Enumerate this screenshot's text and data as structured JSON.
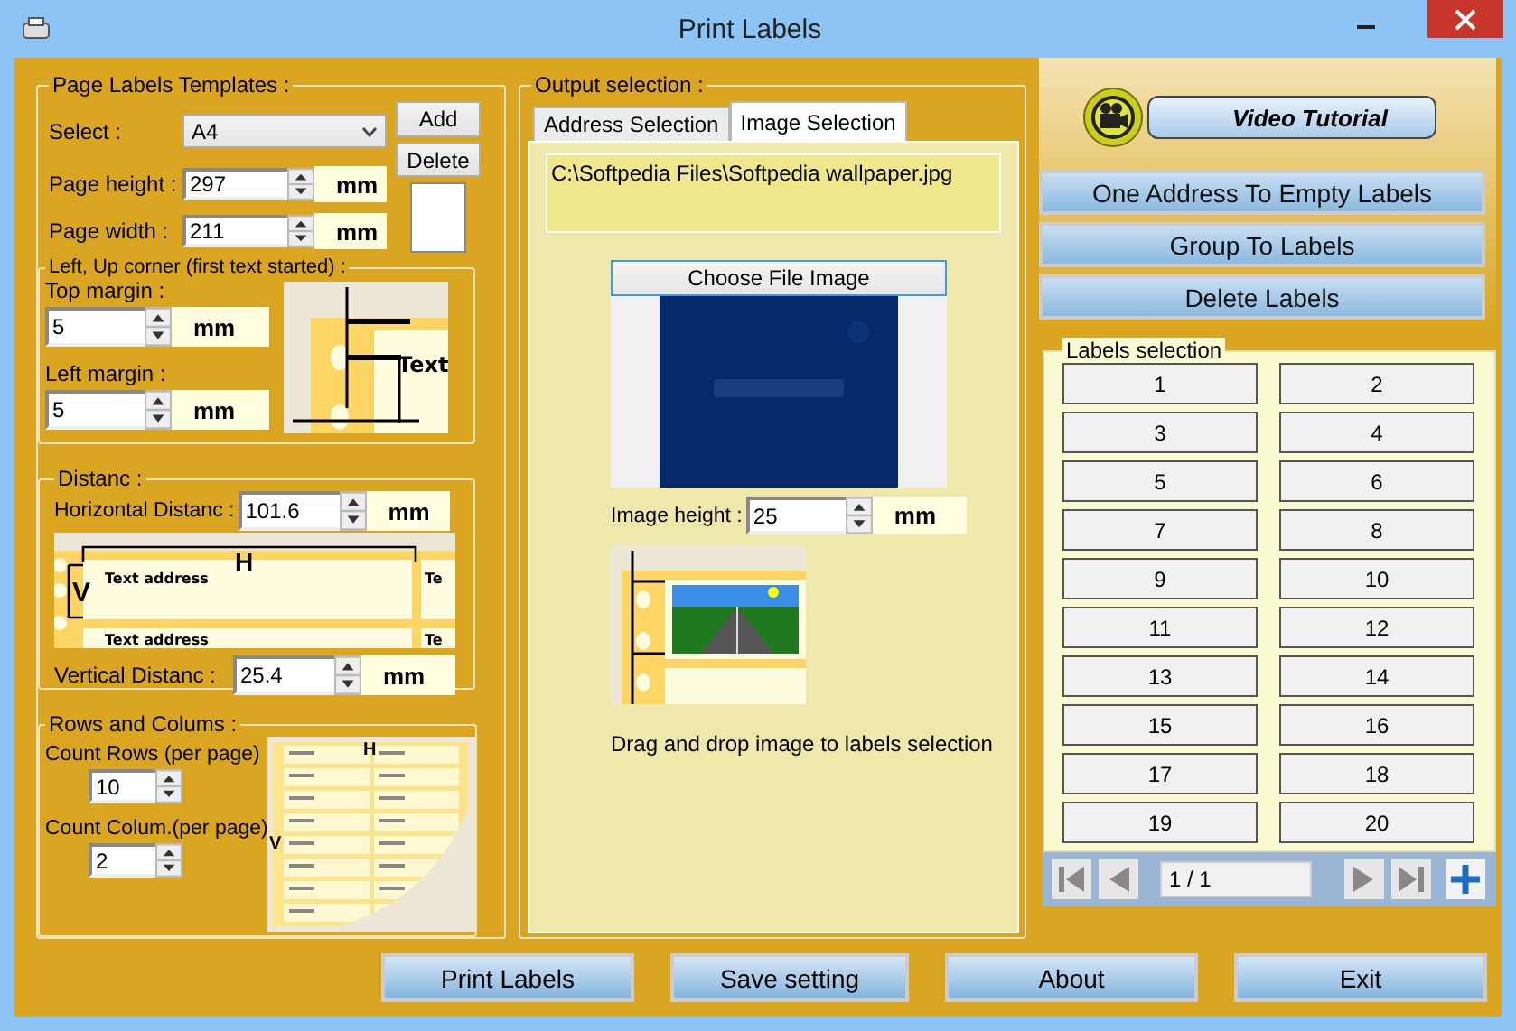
{
  "window": {
    "title": "Print Labels"
  },
  "templates": {
    "legend": "Page Labels Templates :",
    "select_label": "Select :",
    "select_value": "A4",
    "add_button": "Add",
    "delete_button": "Delete",
    "fields": [
      {
        "label": "Page height :",
        "value": "297",
        "unit": "mm"
      },
      {
        "label": "Page width :",
        "value": "211",
        "unit": "mm"
      }
    ]
  },
  "corner": {
    "legend": "Left, Up corner (first text started) :",
    "fields": [
      {
        "label": "Top margin :",
        "value": "5",
        "unit": "mm"
      },
      {
        "label": "Left margin  :",
        "value": "5",
        "unit": "mm"
      }
    ],
    "diagram_text": "Text"
  },
  "distance": {
    "legend": "Distanc :",
    "horizontal": {
      "label": "Horizontal Distanc :",
      "value": "101.6",
      "unit": "mm"
    },
    "vertical": {
      "label": "Vertical Distanc :",
      "value": "25.4",
      "unit": "mm"
    },
    "diagram": {
      "h": "H",
      "v": "V",
      "labels": [
        "Text address",
        "Text address"
      ],
      "cut_labels": [
        "Te",
        "Te"
      ]
    }
  },
  "rows": {
    "legend": "Rows and Colums :",
    "fields": [
      {
        "label": "Count Rows (per page)",
        "value": "10"
      },
      {
        "label": "Count Colum.(per page)",
        "value": "2"
      }
    ],
    "diagram": {
      "h": "H",
      "v": "V"
    }
  },
  "output": {
    "legend": "Output selection :",
    "tabs": [
      {
        "label": "Address Selection",
        "selected": false
      },
      {
        "label": "Image Selection",
        "selected": true
      }
    ],
    "file_path": "C:\\Softpedia Files\\Softpedia wallpaper.jpg",
    "choose_button": "Choose File Image",
    "image_height": {
      "label": "Image height :",
      "value": "25",
      "unit": "mm"
    },
    "hint": "Drag and drop image to labels selection"
  },
  "video_tutorial": "Video Tutorial",
  "actions": [
    "One Address To Empty Labels",
    "Group To Labels",
    "Delete Labels"
  ],
  "labels_selection": {
    "legend": "Labels selection",
    "labels": [
      "1",
      "2",
      "3",
      "4",
      "5",
      "6",
      "7",
      "8",
      "9",
      "10",
      "11",
      "12",
      "13",
      "14",
      "15",
      "16",
      "17",
      "18",
      "19",
      "20"
    ],
    "page": "1 / 1"
  },
  "bottom_buttons": [
    "Print Labels",
    "Save setting",
    "About",
    "Exit"
  ]
}
